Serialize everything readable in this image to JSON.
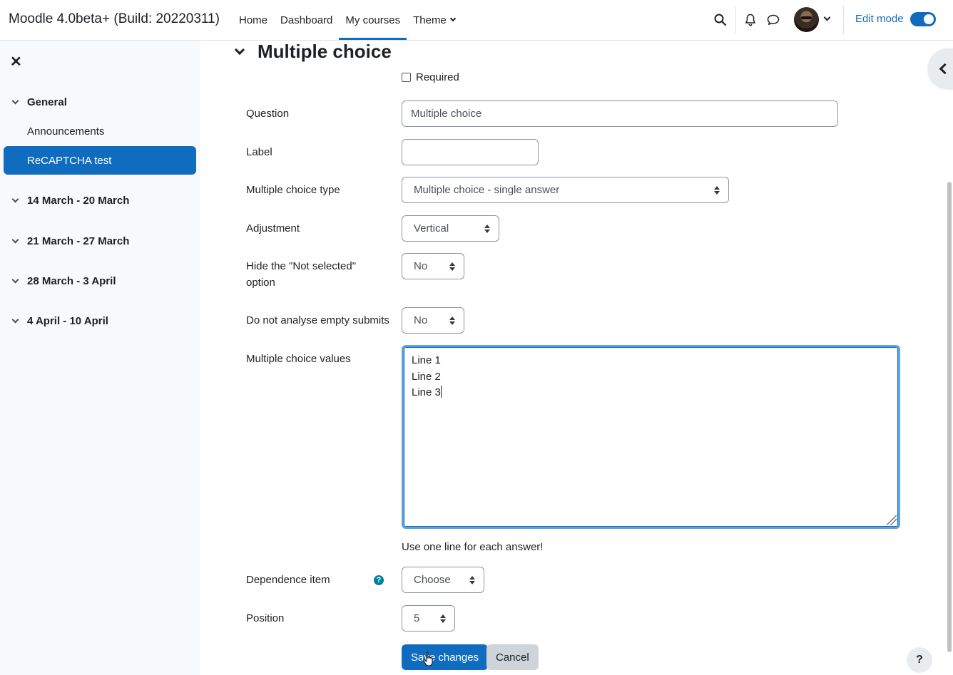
{
  "navbar": {
    "brand": "Moodle 4.0beta+ (Build: 20220311)",
    "links": [
      {
        "label": "Home"
      },
      {
        "label": "Dashboard"
      },
      {
        "label": "My courses"
      },
      {
        "label": "Theme"
      }
    ],
    "edit_mode_label": "Edit mode",
    "edit_mode_on": true
  },
  "drawer": {
    "sections": [
      {
        "label": "General"
      },
      {
        "label": "14 March - 20 March"
      },
      {
        "label": "21 March - 27 March"
      },
      {
        "label": "28 March - 3 April"
      },
      {
        "label": "4 April - 10 April"
      }
    ],
    "items": [
      {
        "label": "Announcements"
      },
      {
        "label": "ReCAPTCHA test"
      }
    ]
  },
  "form": {
    "heading": "Multiple choice",
    "required_label": "Required",
    "question_label": "Question",
    "question_value": "Multiple choice",
    "label_label": "Label",
    "label_value": "",
    "type_label": "Multiple choice type",
    "type_value": "Multiple choice - single answer",
    "adjustment_label": "Adjustment",
    "adjustment_value": "Vertical",
    "hide_label": "Hide the \"Not selected\" option",
    "hide_value": "No",
    "empty_label": "Do not analyse empty submits",
    "empty_value": "No",
    "values_label": "Multiple choice values",
    "values_lines": [
      "Line 1",
      "Line 2",
      "Line 3"
    ],
    "values_help": "Use one line for each answer!",
    "dependence_label": "Dependence item",
    "dependence_value": "Choose",
    "position_label": "Position",
    "position_value": "5",
    "save_label": "Save changes",
    "cancel_label": "Cancel"
  },
  "help_fab": "?"
}
